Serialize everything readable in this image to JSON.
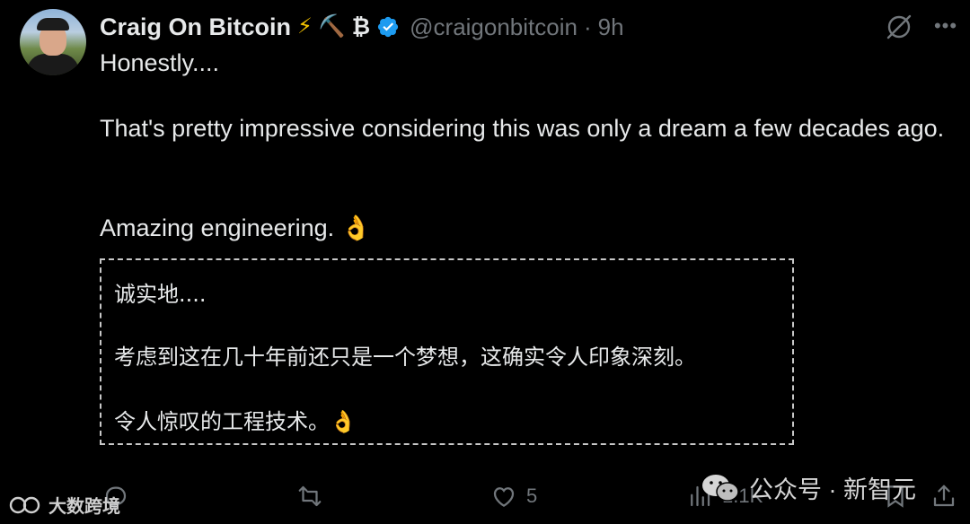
{
  "author": {
    "name": "Craig On Bitcoin",
    "emojis": [
      "⚡",
      "⛏️",
      "₿"
    ],
    "handle": "@craigonbitcoin",
    "separator": "·",
    "time": "9h",
    "verified": true,
    "verified_color": "#1d9bf0"
  },
  "tweet": {
    "line1": "Honestly....",
    "line2": "That's pretty impressive considering this was only a dream a few decades ago.",
    "line3": "Amazing engineering. 👌"
  },
  "translation": {
    "line1": "诚实地....",
    "line2": "考虑到这在几十年前还只是一个梦想，这确实令人印象深刻。",
    "line3": "令人惊叹的工程技术。👌"
  },
  "actions": {
    "reply_count": "",
    "retweet_count": "",
    "like_count": "5",
    "views_count": "1.1K"
  },
  "watermarks": {
    "left": "大数跨境",
    "right": "公众号 · 新智元"
  },
  "icons": [
    "grok-icon",
    "more-icon",
    "reply-icon",
    "retweet-icon",
    "like-icon",
    "views-icon",
    "bookmark-icon",
    "share-icon",
    "verified-badge-icon",
    "wechat-icon"
  ],
  "colors": {
    "background": "#000000",
    "text": "#e7e9ea",
    "muted": "#71767b",
    "accent": "#1d9bf0"
  }
}
